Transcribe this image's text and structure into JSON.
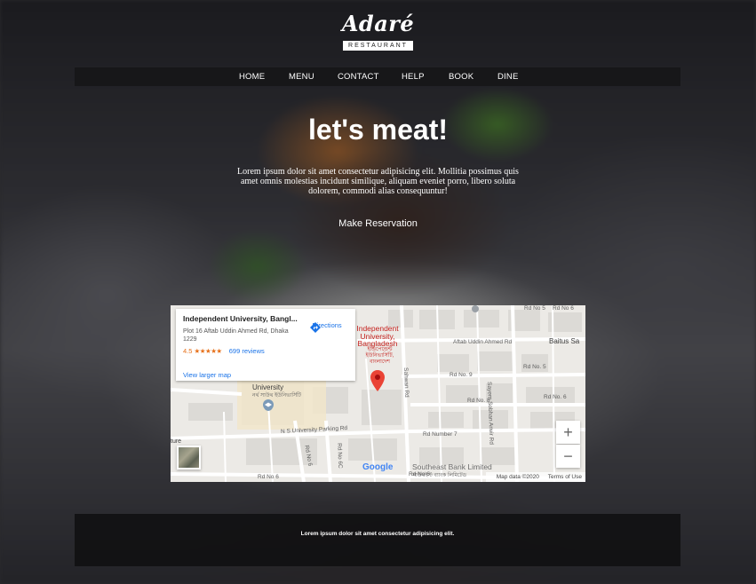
{
  "brand": {
    "logo_script": "Adaré",
    "logo_sub": "RESTAURANT"
  },
  "nav": {
    "items": [
      "HOME",
      "MENU",
      "CONTACT",
      "HELP",
      "BOOK",
      "DINE"
    ]
  },
  "hero": {
    "title": "let's meat!",
    "text": "Lorem ipsum dolor sit amet consectetur adipisicing elit. Mollitia possimus quis amet omnis molestias incidunt similique, aliquam eveniet porro, libero soluta dolorem, commodi alias consequuntur!",
    "cta": "Make Reservation"
  },
  "map": {
    "place_name": "Independent University, Bangl...",
    "address": "Plot 16 Aftab Uddin Ahmed Rd, Dhaka 1229",
    "rating": "4.5",
    "stars": "★★★★★",
    "reviews": "699 reviews",
    "view_larger": "View larger map",
    "directions": "Directions",
    "poi_label": "Independent University, Bangladesh",
    "poi_label_bn": "ইন্ডিপেন্ডেন্ট ইউনিভার্সিটি, বাংলাদেশ",
    "roads": {
      "aftab": "Aftab Uddin Ahmed Rd",
      "baitus": "Baitus Sa",
      "rdno5": "Rd No. 5",
      "rdno6_right": "Rd No. 6",
      "rdno9": "Rd No. 9",
      "rdno8": "Rd No. 8",
      "rdno7": "Rd Number 7",
      "rdno6_bottom": "Rd No 6",
      "rdno6_left": "Rd No 6",
      "rdno5_top": "Rd No 5",
      "rdno6_top": "Rd No 6",
      "parking": "N S University Parking Rd",
      "rdno6_vertical": "Rd No 6",
      "rdno6c": "Rd No 6C",
      "sayem": "Sayem Sobhan Anvir Rd",
      "sahwan": "Sahwan Rd",
      "university": "University",
      "university_bn": "নর্থ সাউথ ইউনিভার্সিটি",
      "ture": "ture"
    },
    "southeast_bank": "Southeast Bank Limited",
    "southeast_bank_bn": "সাউথইস্ট ব্যাংক লিমিটেড",
    "zoom_in": "+",
    "zoom_out": "−",
    "map_data": "Map data ©2020",
    "terms": "Terms of Use",
    "google": "Google",
    "colors": {
      "pin": "#ea4335",
      "link": "#1a73e8",
      "rating": "#e7711b"
    }
  },
  "footer": {
    "text": "Lorem ipsum dolor sit amet consectetur adipisicing elit."
  }
}
